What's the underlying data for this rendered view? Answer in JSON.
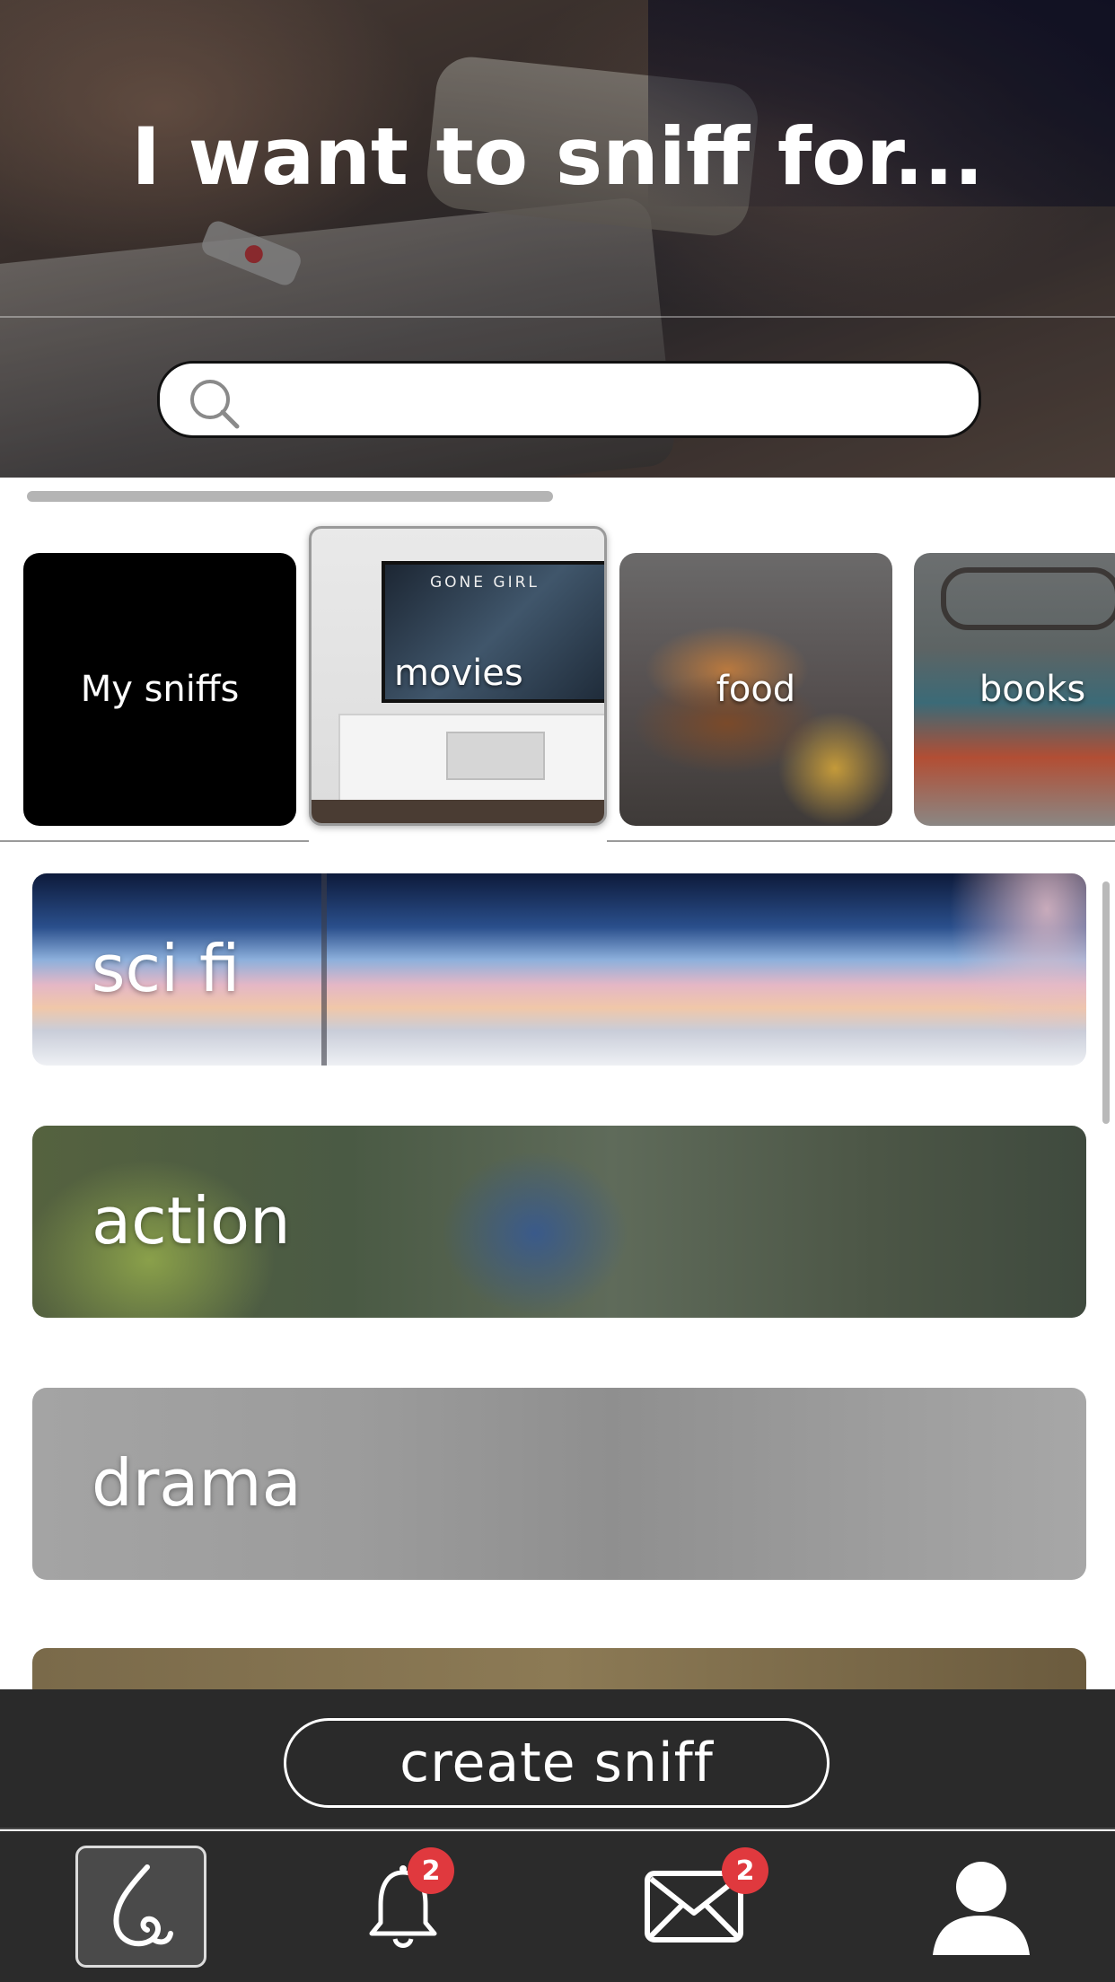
{
  "hero": {
    "title": "I want to sniff for...",
    "search": {
      "value": "",
      "placeholder": ""
    }
  },
  "categories": [
    {
      "label": "My sniffs",
      "selected": false
    },
    {
      "label": "movies",
      "selected": true
    },
    {
      "label": "food",
      "selected": false
    },
    {
      "label": "books",
      "selected": false
    }
  ],
  "movies_tile": {
    "tv_title": "GONE GIRL"
  },
  "genres": [
    {
      "label": "sci fi"
    },
    {
      "label": "action"
    },
    {
      "label": "drama"
    }
  ],
  "create_button": {
    "label": "create sniff"
  },
  "tabbar": {
    "items": [
      {
        "icon": "nose-icon",
        "active": true
      },
      {
        "icon": "bell-icon",
        "badge": "2"
      },
      {
        "icon": "mail-icon",
        "badge": "2"
      },
      {
        "icon": "user-icon"
      }
    ]
  },
  "colors": {
    "badge": "#e0393e",
    "bar": "#2a2a2a",
    "accent_white": "#ffffff"
  }
}
